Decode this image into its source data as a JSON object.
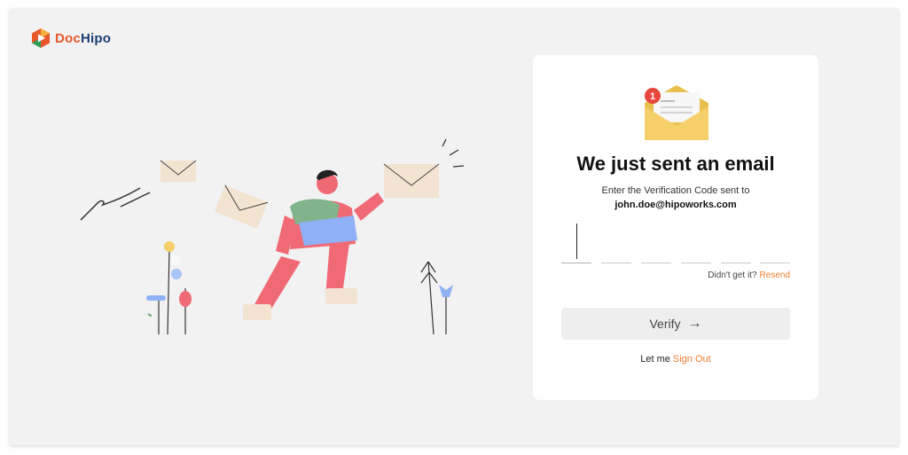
{
  "brand": {
    "name_part1": "Doc",
    "name_part2": "Hipo"
  },
  "card": {
    "badge_count": "1",
    "title": "We just sent an email",
    "subtitle": "Enter the Verification Code sent to",
    "email": "john.doe@hipoworks.com",
    "code_fields": [
      "",
      "",
      "",
      "",
      "",
      ""
    ],
    "resend_prompt": "Didn't get it?",
    "resend_link": "Resend",
    "verify_label": "Verify",
    "signout_prompt": "Let me",
    "signout_link": "Sign Out"
  },
  "colors": {
    "accent": "#f07c2e",
    "brand_orange": "#e8572a",
    "brand_navy": "#1a3d73",
    "envelope_yellow": "#f4cf6a",
    "badge_red": "#e8473c"
  },
  "icons": {
    "logo": "dochipo-logo-icon",
    "mail": "envelope-notification-icon",
    "verify_arrow": "arrow-right-icon"
  }
}
